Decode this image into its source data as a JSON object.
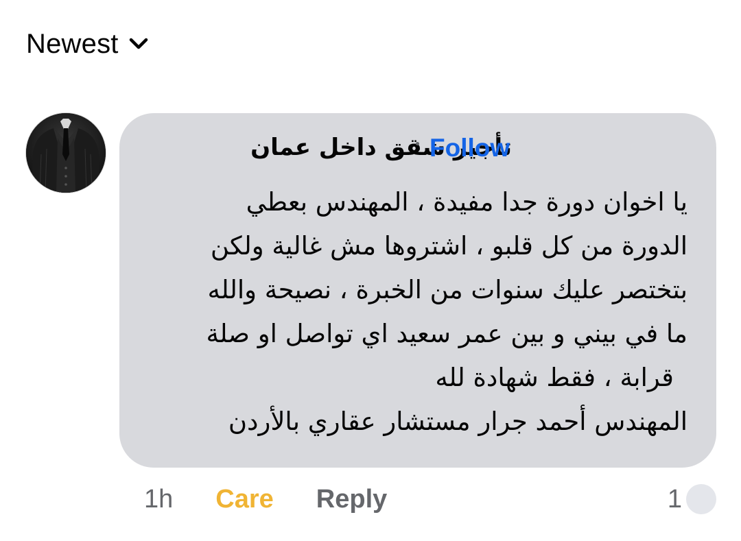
{
  "sort": {
    "label": "Newest",
    "icon": "chevron-down-icon"
  },
  "comment": {
    "author": "تأجير شقق داخل عمان",
    "separator": "·",
    "follow_label": "Follow",
    "lines": [
      "يا اخوان دورة جدا مفيدة ، المهندس بعطي",
      "الدورة من كل قلبو ، اشتروها مش غالية ولكن",
      "بتختصر عليك سنوات من الخبرة ، نصيحة والله",
      "ما في بيني و بين عمر سعيد اي تواصل او صلة",
      "قرابة ، فقط شهادة لله",
      "المهندس أحمد جرار مستشار عقاري بالأردن"
    ],
    "time": "1h",
    "reaction_label": "Care",
    "reply_label": "Reply",
    "reaction_count": "1"
  },
  "colors": {
    "follow": "#1464e6",
    "care": "#f0b434",
    "muted": "#65676b",
    "bubble": "#d8d9dd"
  }
}
